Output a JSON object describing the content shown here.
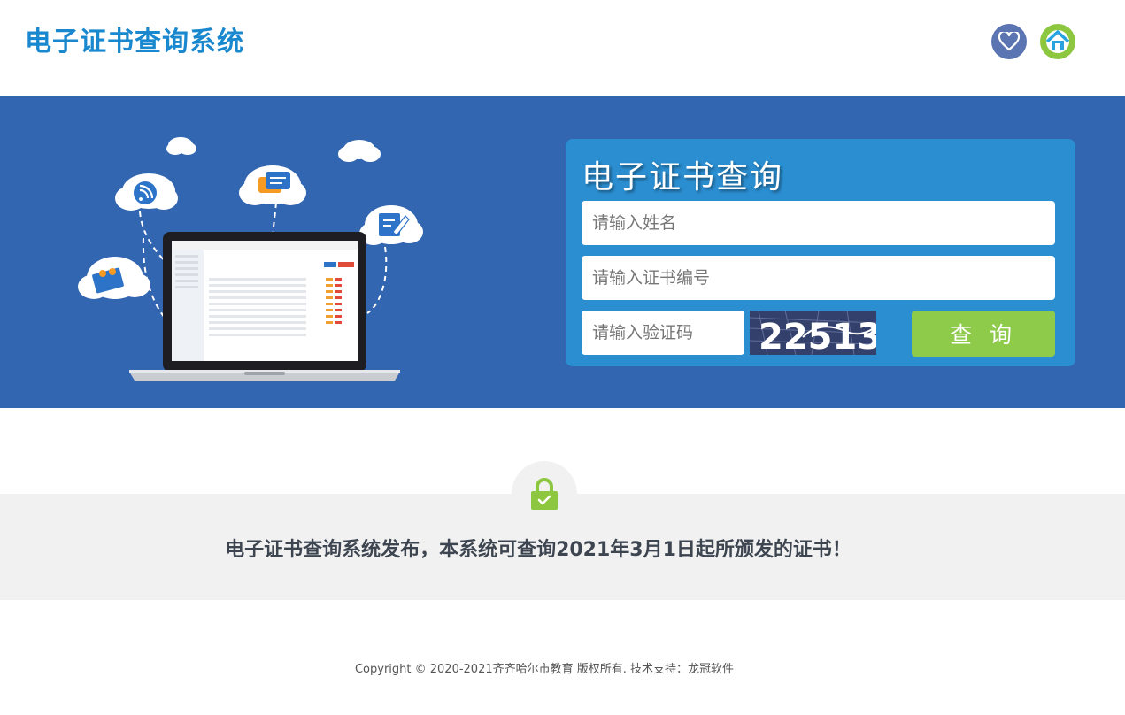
{
  "header": {
    "title": "电子证书查询系统",
    "favorite_icon": "heart-icon",
    "home_icon": "home-icon"
  },
  "query_panel": {
    "title": "电子证书查询",
    "name_placeholder": "请输入姓名",
    "cert_placeholder": "请输入证书编号",
    "code_placeholder": "请输入验证码",
    "captcha_text": "22513",
    "submit_label": "查 询"
  },
  "notice": {
    "icon": "lock-check-icon",
    "text": "电子证书查询系统发布，本系统可查询2021年3月1日起所颁发的证书！"
  },
  "footer": {
    "text": "Copyright © 2020-2021齐齐哈尔市教育 版权所有. 技术支持：龙冠软件"
  },
  "colors": {
    "brand_blue": "#1a88cf",
    "banner_bg": "#3366b1",
    "panel_bg": "#2b8ed1",
    "button_green": "#8fcb4a",
    "notice_bg": "#f1f1f1"
  }
}
